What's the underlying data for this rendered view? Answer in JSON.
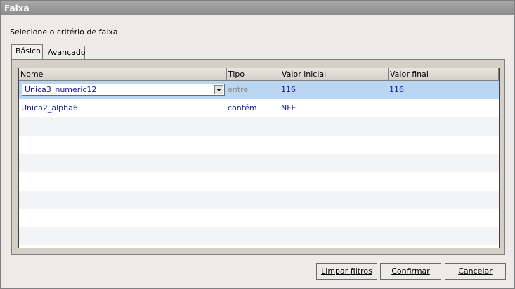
{
  "window": {
    "title": "Faixa"
  },
  "prompt": "Selecione o critério de faixa",
  "tabs": [
    {
      "label": "Básico",
      "active": true
    },
    {
      "label": "Avançado",
      "active": false
    }
  ],
  "table": {
    "columns": [
      "Nome",
      "Tipo",
      "Valor inicial",
      "Valor final"
    ],
    "rows": [
      {
        "nome": "Unica3_numeric12",
        "tipo": "entre",
        "valor_inicial": "116",
        "valor_final": "116",
        "selected": true,
        "editing": true
      },
      {
        "nome": "Unica2_alpha6",
        "tipo": "contém",
        "valor_inicial": "NFE",
        "valor_final": ""
      }
    ]
  },
  "buttons": {
    "clear": "Limpar filtros",
    "confirm": "Confirmar",
    "cancel": "Cancelar"
  },
  "colors": {
    "selected_row": "#b9d6f2",
    "cell_text": "#1a1a99",
    "title_bar": "#9a9a9a"
  }
}
